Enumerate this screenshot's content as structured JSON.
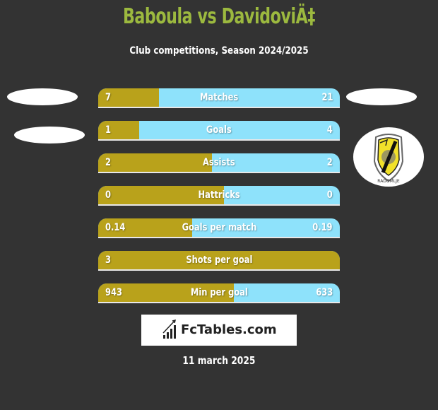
{
  "header": {
    "title": "Baboula vs DavidoviÄ‡",
    "subtitle": "Club competitions, Season 2024/2025"
  },
  "colors": {
    "background": "#333333",
    "title": "#9cb93f",
    "left_bar": "#b9a21b",
    "right_bar": "#8ee2fb",
    "text": "#ffffff"
  },
  "left_player": {
    "avatar": "placeholder-oval",
    "team_logo": "placeholder-oval"
  },
  "right_player": {
    "avatar": "placeholder-oval",
    "team_logo": "club-crest-radomlje-icon",
    "crest_text": "RADOMLJE"
  },
  "stats": [
    {
      "label": "Matches",
      "left": "7",
      "right": "21",
      "left_share": 0.25
    },
    {
      "label": "Goals",
      "left": "1",
      "right": "4",
      "left_share": 0.17
    },
    {
      "label": "Assists",
      "left": "2",
      "right": "2",
      "left_share": 0.47
    },
    {
      "label": "Hattricks",
      "left": "0",
      "right": "0",
      "left_share": 0.52
    },
    {
      "label": "Goals per match",
      "left": "0.14",
      "right": "0.19",
      "left_share": 0.39
    },
    {
      "label": "Shots per goal",
      "left": "3",
      "right": "",
      "left_share": 1.0
    },
    {
      "label": "Min per goal",
      "left": "943",
      "right": "633",
      "left_share": 0.56
    }
  ],
  "footer": {
    "brand": "FcTables.com",
    "date": "11 march 2025"
  }
}
